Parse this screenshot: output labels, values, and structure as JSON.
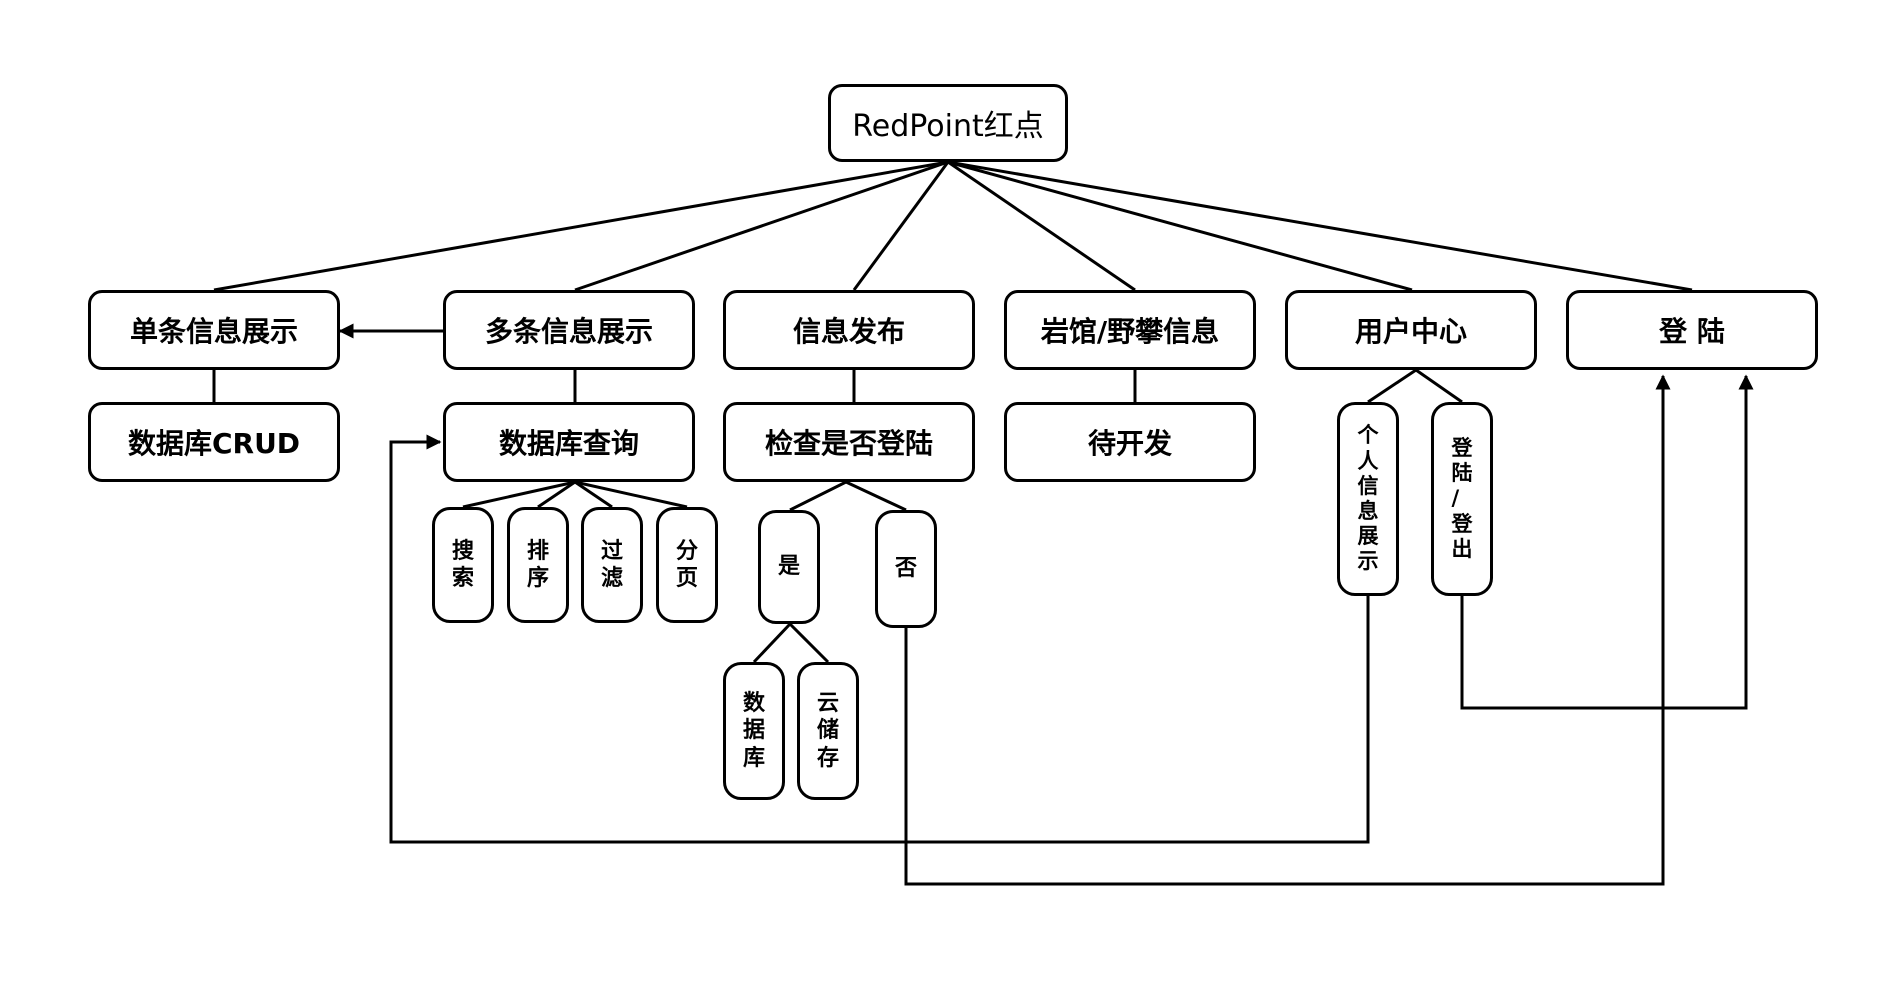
{
  "root": "RedPoint红点",
  "branches": {
    "single": "单条信息展示",
    "multi": "多条信息展示",
    "publish": "信息发布",
    "gym": "岩馆/野攀信息",
    "user": "用户中心",
    "login": "登 陆"
  },
  "sub": {
    "crud": "数据库CRUD",
    "query": "数据库查询",
    "check_login": "检查是否登陆",
    "todo": "待开发"
  },
  "query_ops": [
    "搜\n索",
    "排\n序",
    "过\n滤",
    "分\n页"
  ],
  "check_results": {
    "yes": "是",
    "no": "否"
  },
  "storage": [
    "数\n据\n库",
    "云\n储\n存"
  ],
  "user_items": [
    "个\n人\n信\n息\n展\n示",
    "登\n陆\n/\n登\n出"
  ]
}
